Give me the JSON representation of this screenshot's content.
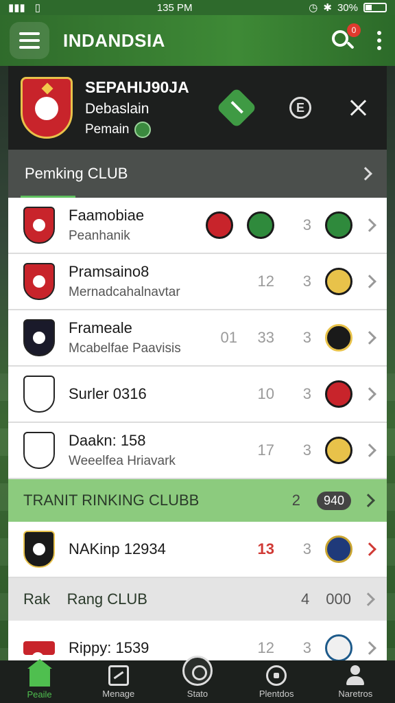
{
  "status": {
    "time": "135 PM",
    "battery": "30%"
  },
  "appbar": {
    "title": "INDANDSIA",
    "notif_count": "0"
  },
  "team": {
    "name": "SEPAHIJ90JA",
    "subtitle": "Debaslain",
    "league": "Pemain",
    "crest_color": "#c8242b"
  },
  "section": {
    "label": "Pemking CLUB"
  },
  "rows": [
    {
      "name": "Faamobiae",
      "desc": "Peanhanik",
      "v1": "",
      "v2": "3",
      "crest": "#c8242b"
    },
    {
      "name": "Pramsaino8",
      "desc": "Mernadcahalnavtar",
      "v1": "12",
      "v2": "3",
      "crest": "#c8242b"
    },
    {
      "name": "Frameale",
      "desc": "Mcabelfae Paavisis",
      "v0": "01",
      "v1": "33",
      "v2": "3",
      "crest": "#1a1a2a"
    },
    {
      "name": "Surler 0316",
      "desc": "",
      "v1": "10",
      "v2": "3",
      "crest": "#ffffff"
    },
    {
      "name": "Daakn: 158",
      "desc": "Weeelfea Hriavark",
      "v1": "17",
      "v2": "3",
      "crest": "#ffffff"
    }
  ],
  "group1": {
    "label": "TRANIT RINKING CLUBB",
    "num": "2",
    "pill": "940"
  },
  "row_special": {
    "name": "NAKinp 12934",
    "v1": "13",
    "v2": "3",
    "crest": "#1a1a1a"
  },
  "group2": {
    "label": "Rak    Rang CLUB",
    "num": "4",
    "num2": "000"
  },
  "row_last": {
    "name": "Rippy: 1539",
    "v1": "12",
    "v2": "3"
  },
  "nav": {
    "home": "Peaile",
    "manage": "Menage",
    "stats": "Stato",
    "matches": "Plentdos",
    "profile": "Naretros"
  },
  "colors": {
    "accent": "#4fbf4f",
    "header": "#2f6b2b",
    "alert": "#d03a35"
  }
}
